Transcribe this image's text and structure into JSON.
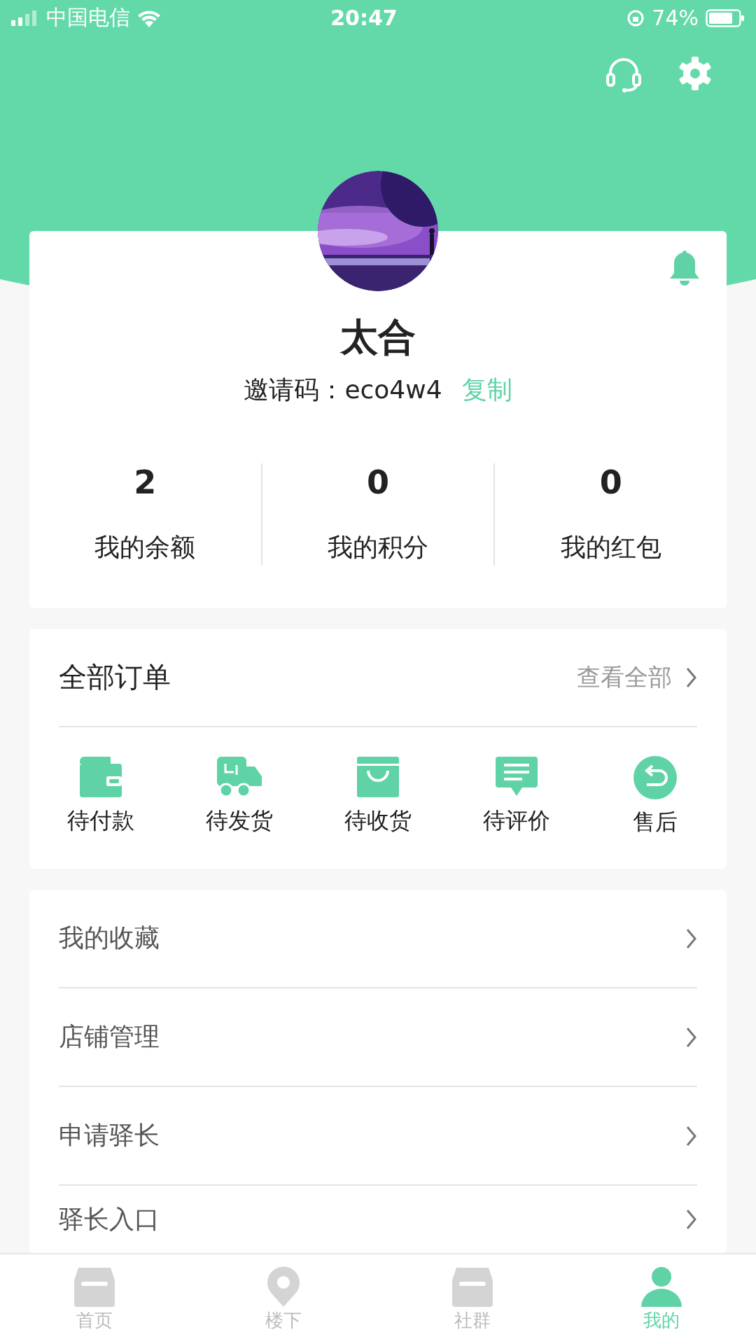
{
  "status_bar": {
    "carrier": "中国电信",
    "time": "20:47",
    "battery": "74%"
  },
  "profile": {
    "name": "太合",
    "invite_label": "邀请码：",
    "invite_code": "eco4w4",
    "copy": "复制"
  },
  "stats": [
    {
      "value": "2",
      "label": "我的余额"
    },
    {
      "value": "0",
      "label": "我的积分"
    },
    {
      "value": "0",
      "label": "我的红包"
    }
  ],
  "orders": {
    "title": "全部订单",
    "view_all": "查看全部",
    "items": [
      {
        "label": "待付款",
        "kind": "wallet"
      },
      {
        "label": "待发货",
        "kind": "truck"
      },
      {
        "label": "待收货",
        "kind": "bag"
      },
      {
        "label": "待评价",
        "kind": "chat"
      },
      {
        "label": "售后",
        "kind": "return"
      }
    ]
  },
  "menu": [
    {
      "label": "我的收藏"
    },
    {
      "label": "店铺管理"
    },
    {
      "label": "申请驿长"
    },
    {
      "label": "驿长入口"
    }
  ],
  "tab_bar": [
    {
      "label": "首页",
      "kind": "shop",
      "selected": false
    },
    {
      "label": "楼下",
      "kind": "pin",
      "selected": false
    },
    {
      "label": "社群",
      "kind": "shop",
      "selected": false
    },
    {
      "label": "我的",
      "kind": "person",
      "selected": true
    }
  ]
}
